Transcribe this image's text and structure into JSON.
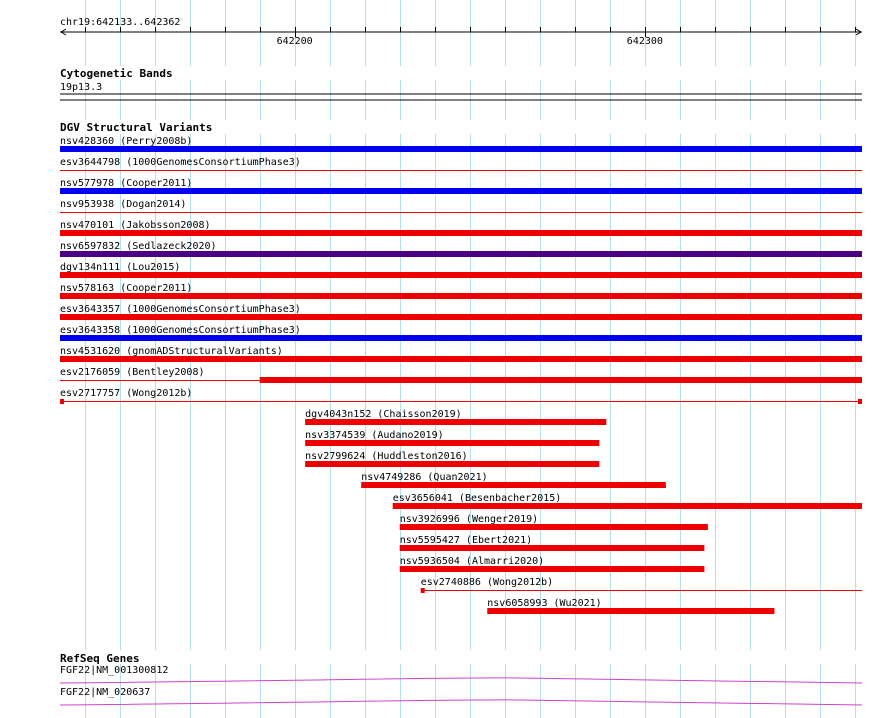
{
  "ruler": {
    "position_label": "chr19:642133..642362",
    "start": 642133,
    "end": 642362,
    "ticks": [
      642200,
      642300
    ],
    "tick_labels": [
      "642200",
      "642300"
    ]
  },
  "cytoband": {
    "title": "Cytogenetic Bands",
    "band_label": "19p13.3"
  },
  "dgv": {
    "title": "DGV Structural Variants",
    "features": [
      {
        "label": "nsv428360 (Perry2008b)",
        "start": 642133,
        "end": 642362,
        "color": "#0000ee",
        "style": "bar"
      },
      {
        "label": "esv3644798 (1000GenomesConsortiumPhase3)",
        "start": 642133,
        "end": 642362,
        "color": "#ee0000",
        "style": "line"
      },
      {
        "label": "nsv577978 (Cooper2011)",
        "start": 642133,
        "end": 642362,
        "color": "#0000ee",
        "style": "bar"
      },
      {
        "label": "nsv953938 (Dogan2014)",
        "start": 642133,
        "end": 642362,
        "color": "#ee0000",
        "style": "line"
      },
      {
        "label": "nsv470101 (Jakobsson2008)",
        "start": 642133,
        "end": 642362,
        "color": "#ee0000",
        "style": "bar"
      },
      {
        "label": "nsv6597832 (Sedlazeck2020)",
        "start": 642133,
        "end": 642362,
        "color": "#4b0082",
        "style": "bar"
      },
      {
        "label": "dgv134n111 (Lou2015)",
        "start": 642133,
        "end": 642362,
        "color": "#ee0000",
        "style": "bar"
      },
      {
        "label": "nsv578163 (Cooper2011)",
        "start": 642133,
        "end": 642362,
        "color": "#ee0000",
        "style": "bar"
      },
      {
        "label": "esv3643357 (1000GenomesConsortiumPhase3)",
        "start": 642133,
        "end": 642362,
        "color": "#ee0000",
        "style": "bar"
      },
      {
        "label": "esv3643358 (1000GenomesConsortiumPhase3)",
        "start": 642133,
        "end": 642362,
        "color": "#0000ee",
        "style": "bar"
      },
      {
        "label": "nsv4531620 (gnomADStructuralVariants)",
        "start": 642133,
        "end": 642362,
        "color": "#ee0000",
        "style": "bar"
      },
      {
        "label": "esv2176059 (Bentley2008)",
        "start": 642133,
        "end": 642362,
        "color": "#ee0000",
        "style": "bar_partial",
        "thick_start": 642190
      },
      {
        "label": "esv2717757 (Wong2012b)",
        "start": 642133,
        "end": 642362,
        "color": "#ee0000",
        "style": "line_ends"
      },
      {
        "label": "dgv4043n152 (Chaisson2019)",
        "start": 642203,
        "end": 642289,
        "color": "#ee0000",
        "style": "bar"
      },
      {
        "label": "nsv3374539 (Audano2019)",
        "start": 642203,
        "end": 642287,
        "color": "#ee0000",
        "style": "bar"
      },
      {
        "label": "nsv2799624 (Huddleston2016)",
        "start": 642203,
        "end": 642287,
        "color": "#ee0000",
        "style": "bar"
      },
      {
        "label": "nsv4749286 (Quan2021)",
        "start": 642219,
        "end": 642306,
        "color": "#ee0000",
        "style": "bar"
      },
      {
        "label": "esv3656041 (Besenbacher2015)",
        "start": 642228,
        "end": 642362,
        "color": "#ee0000",
        "style": "bar"
      },
      {
        "label": "nsv3926996 (Wenger2019)",
        "start": 642230,
        "end": 642318,
        "color": "#ee0000",
        "style": "bar"
      },
      {
        "label": "nsv5595427 (Ebert2021)",
        "start": 642230,
        "end": 642317,
        "color": "#ee0000",
        "style": "bar"
      },
      {
        "label": "nsv5936504 (Almarri2020)",
        "start": 642230,
        "end": 642317,
        "color": "#ee0000",
        "style": "bar"
      },
      {
        "label": "esv2740886 (Wong2012b)",
        "start": 642236,
        "end": 642362,
        "color": "#ee0000",
        "style": "line_start"
      },
      {
        "label": "nsv6058993 (Wu2021)",
        "start": 642255,
        "end": 642337,
        "color": "#ee0000",
        "style": "bar"
      }
    ]
  },
  "refseq": {
    "title": "RefSeq Genes",
    "color": "#cc44cc",
    "genes": [
      {
        "label": "FGF22|NM_001300812"
      },
      {
        "label": "FGF22|NM_020637"
      }
    ]
  }
}
